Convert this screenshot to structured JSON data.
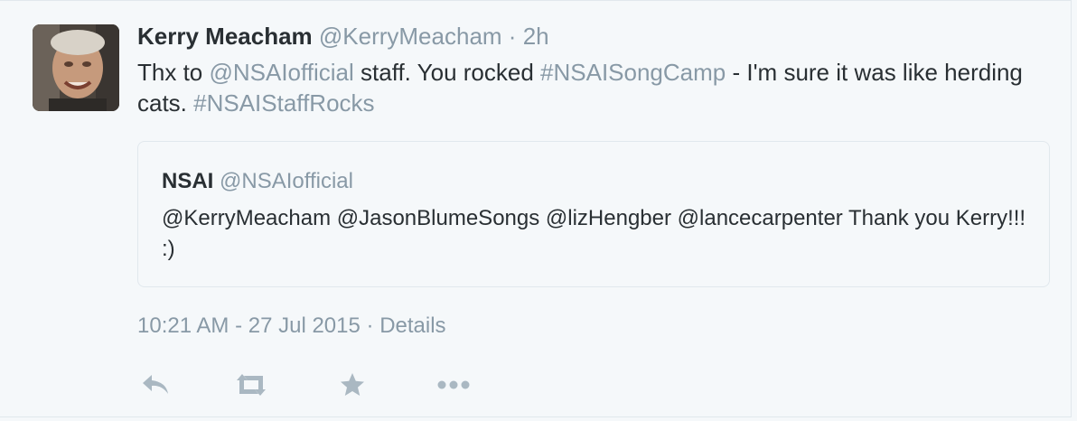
{
  "tweet": {
    "name": "Kerry Meacham",
    "handle": "@KerryMeacham",
    "separator": "·",
    "time": "2h",
    "text_parts": {
      "p1": "Thx to ",
      "link1": "@NSAIofficial",
      "p2": " staff. You rocked ",
      "link2": "#NSAISongCamp",
      "p3": " - I'm sure it was like herding cats. ",
      "link3": "#NSAIStaffRocks"
    },
    "timestamp": "10:21 AM - 27 Jul 2015",
    "meta_separator": "·",
    "details_label": "Details"
  },
  "quote": {
    "name": "NSAI",
    "handle": "@NSAIofficial",
    "text": "@KerryMeacham @JasonBlumeSongs @lizHengber @lancecarpenter Thank you Kerry!!! :)"
  },
  "actions": {
    "icons": [
      "reply-icon",
      "retweet-icon",
      "favorite-icon",
      "more-icon"
    ]
  },
  "colors": {
    "background": "#f5f8fa",
    "text": "#292f33",
    "muted": "#8899a6",
    "border": "#e1e8ed"
  }
}
